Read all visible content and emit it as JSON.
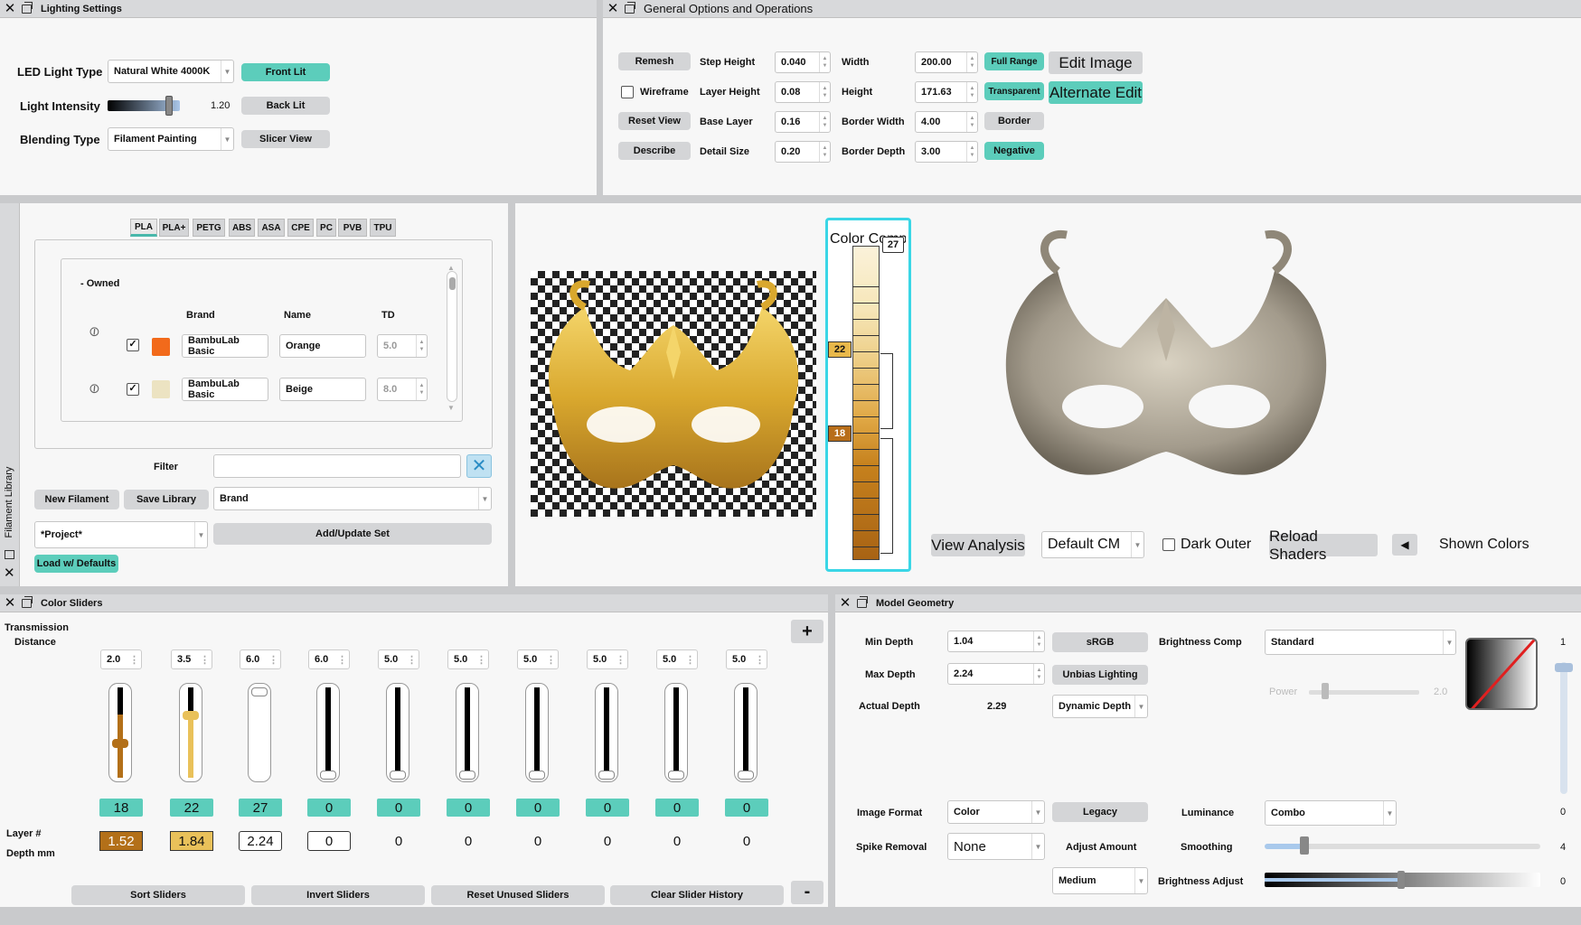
{
  "lighting": {
    "title": "Lighting Settings",
    "led_label": "LED Light Type",
    "led_value": "Natural White 4000K",
    "intensity_label": "Light Intensity",
    "intensity_value": "1.20",
    "intensity_level": 0.6,
    "blending_label": "Blending Type",
    "blending_value": "Filament Painting",
    "front_lit": "Front Lit",
    "back_lit": "Back Lit",
    "slicer_view": "Slicer View"
  },
  "general": {
    "title": "General Options and Operations",
    "remesh": "Remesh",
    "wireframe": "Wireframe",
    "reset_view": "Reset View",
    "describe": "Describe",
    "step_height_label": "Step Height",
    "step_height": "0.040",
    "layer_height_label": "Layer Height",
    "layer_height": "0.08",
    "base_layer_label": "Base Layer",
    "base_layer": "0.16",
    "detail_size_label": "Detail Size",
    "detail_size": "0.20",
    "width_label": "Width",
    "width": "200.00",
    "height_label": "Height",
    "height": "171.63",
    "border_width_label": "Border Width",
    "border_width": "4.00",
    "border_depth_label": "Border Depth",
    "border_depth": "3.00",
    "full_range": "Full Range",
    "transparent": "Transparent",
    "border": "Border",
    "negative": "Negative",
    "edit_image": "Edit Image",
    "alternate_edit": "Alternate Edit"
  },
  "library": {
    "side_title": "Filament Library",
    "tabs": [
      "PLA",
      "PLA+",
      "PETG",
      "ABS",
      "ASA",
      "CPE",
      "PC",
      "PVB",
      "TPU"
    ],
    "group": "- Owned",
    "col_brand": "Brand",
    "col_name": "Name",
    "col_td": "TD",
    "rows": [
      {
        "brand": "BambuLab Basic",
        "name": "Orange",
        "td": "5.0",
        "color": "#f26a1b"
      },
      {
        "brand": "BambuLab Basic",
        "name": "Beige",
        "td": "8.0",
        "color": "#ece3c2"
      }
    ],
    "filter_label": "Filter",
    "new_filament": "New Filament",
    "save_library": "Save Library",
    "sort_value": "Brand",
    "project_value": "*Project*",
    "add_update": "Add/Update Set",
    "load_defaults": "Load w/ Defaults"
  },
  "viewer": {
    "color_comp_label": "Color Comp",
    "marker_top": "27",
    "marker_mid": "22",
    "marker_low": "18",
    "view_analysis": "View Analysis",
    "cm_value": "Default CM",
    "dark_outer": "Dark Outer",
    "reload_shaders": "Reload Shaders",
    "shown_colors": "Shown Colors"
  },
  "sliders": {
    "title": "Color Sliders",
    "td_label_1": "Transmission",
    "td_label_2": "Distance",
    "layer_label": "Layer #",
    "depth_label": "Depth mm",
    "td_values": [
      "2.0",
      "3.5",
      "6.0",
      "6.0",
      "5.0",
      "5.0",
      "5.0",
      "5.0",
      "5.0",
      "5.0"
    ],
    "layers": [
      "18",
      "22",
      "27",
      "0",
      "0",
      "0",
      "0",
      "0",
      "0",
      "0"
    ],
    "depths": [
      "1.52",
      "1.84",
      "2.24",
      "0",
      "0",
      "0",
      "0",
      "0",
      "0",
      "0"
    ],
    "levels": [
      0.38,
      0.72,
      1.0,
      0,
      0,
      0,
      0,
      0,
      0,
      0
    ],
    "sort": "Sort Sliders",
    "invert": "Invert Sliders",
    "reset_unused": "Reset Unused Sliders",
    "clear_history": "Clear Slider History",
    "plus": "+",
    "minus": "-"
  },
  "geometry": {
    "title": "Model Geometry",
    "min_depth_label": "Min Depth",
    "min_depth": "1.04",
    "max_depth_label": "Max Depth",
    "max_depth": "2.24",
    "actual_depth_label": "Actual Depth",
    "actual_depth": "2.29",
    "srgb": "sRGB",
    "unbias": "Unbias Lighting",
    "dynamic_depth": "Dynamic Depth",
    "brightness_comp_label": "Brightness Comp",
    "brightness_comp": "Standard",
    "power_label": "Power",
    "power_value": "2.0",
    "right_value_top": "1",
    "right_value_zero": "0",
    "image_format_label": "Image Format",
    "image_format": "Color",
    "legacy": "Legacy",
    "luminance_label": "Luminance",
    "luminance": "Combo",
    "spike_label": "Spike Removal",
    "spike": "None",
    "adjust_amount": "Adjust Amount",
    "smoothing_label": "Smoothing",
    "smoothing_value": "4",
    "medium": "Medium",
    "brightness_adjust_label": "Brightness Adjust",
    "brightness_adjust_value": "0"
  }
}
